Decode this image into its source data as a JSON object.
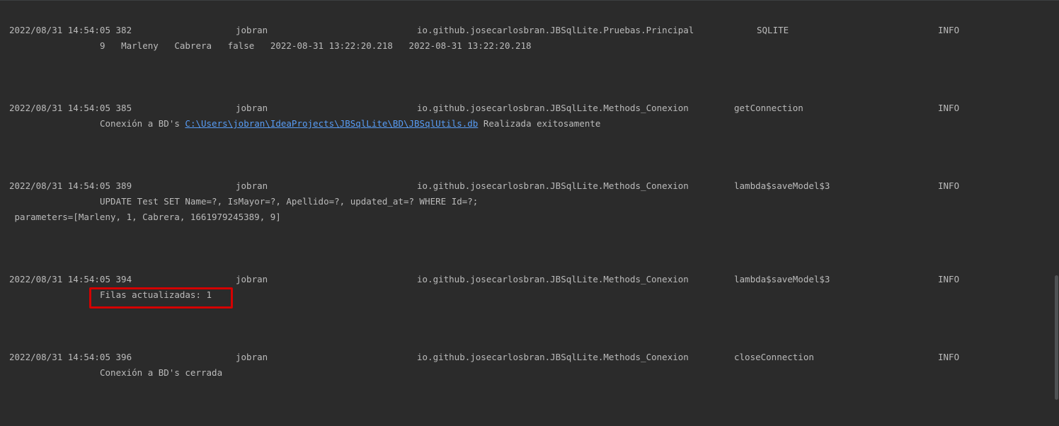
{
  "entries": [
    {
      "timestamp": "2022/08/31 14:54:05 382",
      "user": "jobran",
      "class_name": "io.github.josecarlosbran.JBSqlLite.Pruebas.Principal",
      "method": "SQLITE",
      "level": "INFO",
      "message": "9   Marleny   Cabrera   false   2022-08-31 13:22:20.218   2022-08-31 13:22:20.218"
    },
    {
      "timestamp": "2022/08/31 14:54:05 385",
      "user": "jobran",
      "class_name": "io.github.josecarlosbran.JBSqlLite.Methods_Conexion",
      "method": "getConnection",
      "level": "INFO",
      "message_prefix": "Conexión a BD's ",
      "message_link": "C:\\Users\\jobran\\IdeaProjects\\JBSqlLite\\BD\\JBSqlUtils.db",
      "message_suffix": " Realizada exitosamente"
    },
    {
      "timestamp": "2022/08/31 14:54:05 389",
      "user": "jobran",
      "class_name": "io.github.josecarlosbran.JBSqlLite.Methods_Conexion",
      "method": "lambda$saveModel$3",
      "level": "INFO",
      "message": "UPDATE Test SET Name=?, IsMayor=?, Apellido=?, updated_at=? WHERE Id=?;",
      "message_line2": " parameters=[Marleny, 1, Cabrera, 1661979245389, 9]"
    },
    {
      "timestamp": "2022/08/31 14:54:05 394",
      "user": "jobran",
      "class_name": "io.github.josecarlosbran.JBSqlLite.Methods_Conexion",
      "method": "lambda$saveModel$3",
      "level": "INFO",
      "message": "Filas actualizadas: 1"
    },
    {
      "timestamp": "2022/08/31 14:54:05 396",
      "user": "jobran",
      "class_name": "io.github.josecarlosbran.JBSqlLite.Methods_Conexion",
      "method": "closeConnection",
      "level": "INFO",
      "message": "Conexión a BD's cerrada"
    }
  ],
  "colors": {
    "background": "#2b2b2b",
    "text": "#bbbbbb",
    "link": "#589df6",
    "highlight": "#d40000"
  }
}
